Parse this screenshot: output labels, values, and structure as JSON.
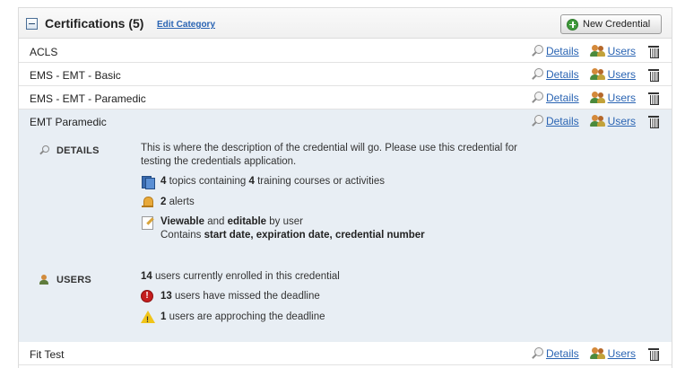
{
  "header": {
    "title": "Certifications (5)",
    "edit_category": "Edit Category",
    "new_credential": "New Credential"
  },
  "actions": {
    "details": "Details",
    "users": "Users"
  },
  "rows": [
    {
      "name": "ACLS"
    },
    {
      "name": "EMS - EMT - Basic"
    },
    {
      "name": "EMS - EMT - Paramedic"
    },
    {
      "name": "EMT Paramedic"
    },
    {
      "name": "Fit Test"
    }
  ],
  "expanded": {
    "details_label": "DETAILS",
    "description_line1": "This is where the description of the credential will go. Please use this credential for",
    "description_line2": "testing the credentials application.",
    "topics_count": "4",
    "topics_text_a": "topics containing",
    "courses_count": "4",
    "topics_text_b": "training courses or activities",
    "alerts_count": "2",
    "alerts_text": "alerts",
    "viewable": "Viewable",
    "and": "and",
    "editable": "editable",
    "by_user": "by user",
    "contains": "Contains",
    "fields": "start date, expiration date, credential number",
    "users_label": "USERS",
    "enrolled_count": "14",
    "enrolled_text": "users currently enrolled in this credential",
    "missed_count": "13",
    "missed_text": "users have missed the deadline",
    "approaching_count": "1",
    "approaching_text": "users are approching the deadline"
  },
  "icons": {
    "collapse": "collapse-minus-icon",
    "new": "plus-circle-icon",
    "details": "magnifier-icon",
    "users": "users-icon",
    "delete": "trash-icon",
    "topics": "book-icon",
    "alerts": "bell-icon",
    "permissions": "edit-document-icon",
    "error": "error-circle-icon",
    "warning": "warning-triangle-icon"
  },
  "colors": {
    "link": "#2a64b3",
    "expanded_bg": "#e8eef4",
    "error": "#c41e1e",
    "warning": "#f0c419",
    "new_icon": "#3f9a3a"
  }
}
